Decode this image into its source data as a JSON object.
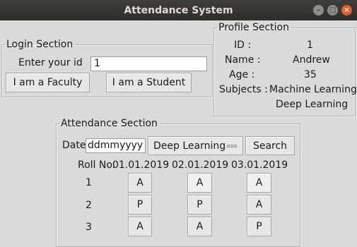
{
  "window": {
    "title": "Attendance System"
  },
  "login": {
    "legend": "Login Section",
    "id_label": "Enter your id",
    "id_value": "1",
    "faculty_button": "I am a Faculty",
    "student_button": "I am a Student"
  },
  "profile": {
    "legend": "Profile Section",
    "id_label": "ID :",
    "id_value": "1",
    "name_label": "Name :",
    "name_value": "Andrew",
    "age_label": "Age :",
    "age_value": "35",
    "subjects_label": "Subjects :",
    "subjects": [
      "Machine Learning",
      "Deep Learning"
    ]
  },
  "attendance": {
    "legend": "Attendance Section",
    "date_label": "Date",
    "date_value": "ddmmyyyy",
    "subject_selected": "Deep Learning",
    "search_button": "Search",
    "headers": [
      "Roll No.",
      "01.01.2019",
      "02.01.2019",
      "03.01.2019"
    ],
    "rows": [
      {
        "roll": "1",
        "marks": [
          "A",
          "A",
          "A"
        ]
      },
      {
        "roll": "2",
        "marks": [
          "P",
          "P",
          "A"
        ]
      },
      {
        "roll": "3",
        "marks": [
          "A",
          "A",
          "P"
        ]
      }
    ]
  }
}
